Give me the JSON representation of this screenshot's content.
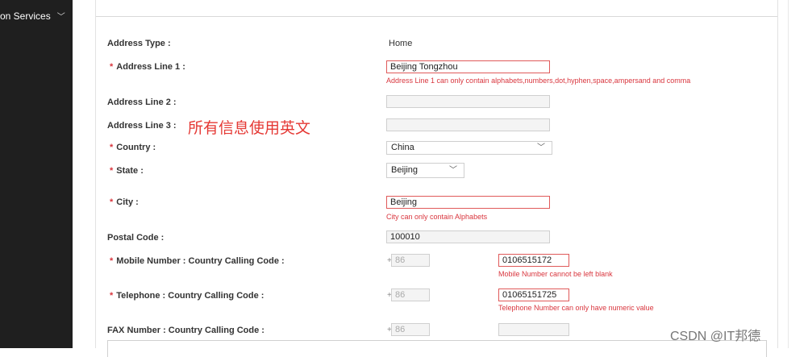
{
  "sidebar": {
    "menu_label": "on Services",
    "chevron_icon": "chevron-down-icon"
  },
  "form": {
    "address_type": {
      "label": "Address Type :",
      "value": "Home"
    },
    "address_line1": {
      "label": "Address Line 1 :",
      "required": true,
      "value": "Beijing Tongzhou",
      "error": "Address Line 1 can only contain alphabets,numbers,dot,hyphen,space,ampersand and comma"
    },
    "address_line2": {
      "label": "Address Line 2 :",
      "value": ""
    },
    "address_line3": {
      "label": "Address Line 3 :",
      "value": ""
    },
    "country": {
      "label": "Country :",
      "required": true,
      "value": "China"
    },
    "state": {
      "label": "State :",
      "required": true,
      "value": "Beijing"
    },
    "city": {
      "label": "City :",
      "required": true,
      "value": "Beijing",
      "error": "City can only contain Alphabets"
    },
    "postal_code": {
      "label": "Postal Code :",
      "value": "100010"
    },
    "mobile": {
      "label": "Mobile Number : Country Calling Code :",
      "required": true,
      "plus": "+",
      "country_code": "86",
      "value": "0106515172",
      "error": "Mobile Number cannot be left blank"
    },
    "telephone": {
      "label": "Telephone : Country Calling Code :",
      "required": true,
      "plus": "+",
      "country_code": "86",
      "value": "01065151725",
      "error": "Telephone Number can only have numeric value"
    },
    "fax": {
      "label": "FAX Number : Country Calling Code :",
      "plus": "+",
      "country_code": "86",
      "value": ""
    }
  },
  "annotation": "所有信息使用英文",
  "watermark": "CSDN @IT邦德",
  "colors": {
    "error": "#d9363e",
    "annotation": "#e53935",
    "sidebar": "#1f1f1f"
  }
}
